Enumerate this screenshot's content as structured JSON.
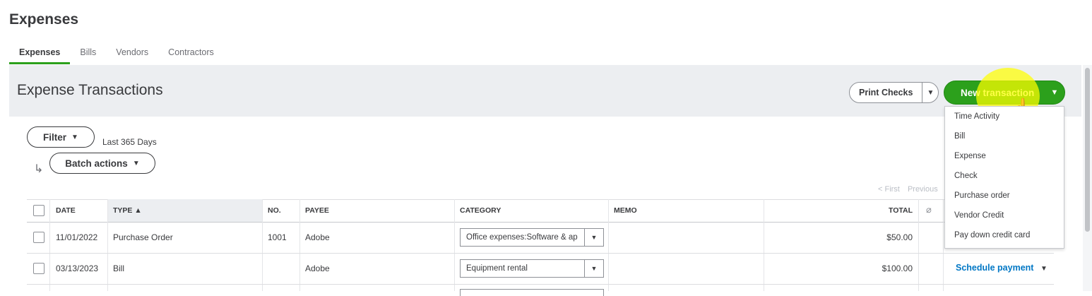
{
  "page": {
    "title": "Expenses"
  },
  "tabs": [
    {
      "label": "Expenses",
      "active": true
    },
    {
      "label": "Bills"
    },
    {
      "label": "Vendors"
    },
    {
      "label": "Contractors"
    }
  ],
  "section": {
    "title": "Expense Transactions"
  },
  "toolbar": {
    "print_checks_label": "Print Checks",
    "new_transaction_label": "New transaction"
  },
  "dropdown": {
    "items": [
      "Time Activity",
      "Bill",
      "Expense",
      "Check",
      "Purchase order",
      "Vendor Credit",
      "Pay down credit card"
    ]
  },
  "filters": {
    "filter_label": "Filter",
    "date_range": "Last 365 Days",
    "batch_label": "Batch actions"
  },
  "pager": {
    "first": "< First",
    "previous": "Previous"
  },
  "table": {
    "columns": {
      "date": "DATE",
      "type": "TYPE ▲",
      "no": "NO.",
      "payee": "PAYEE",
      "category": "CATEGORY",
      "memo": "MEMO",
      "total": "TOTAL"
    },
    "rows": [
      {
        "date": "11/01/2022",
        "type": "Purchase Order",
        "no": "1001",
        "payee": "Adobe",
        "category": "Office expenses:Software & ap",
        "memo": "",
        "total": "$50.00",
        "action": ""
      },
      {
        "date": "03/13/2023",
        "type": "Bill",
        "no": "",
        "payee": "Adobe",
        "category": "Equipment rental",
        "memo": "",
        "total": "$100.00",
        "action": "Schedule payment"
      }
    ]
  },
  "colors": {
    "brand_green": "#2ca01c",
    "link_blue": "#0077c5",
    "header_band": "#eceef1"
  }
}
